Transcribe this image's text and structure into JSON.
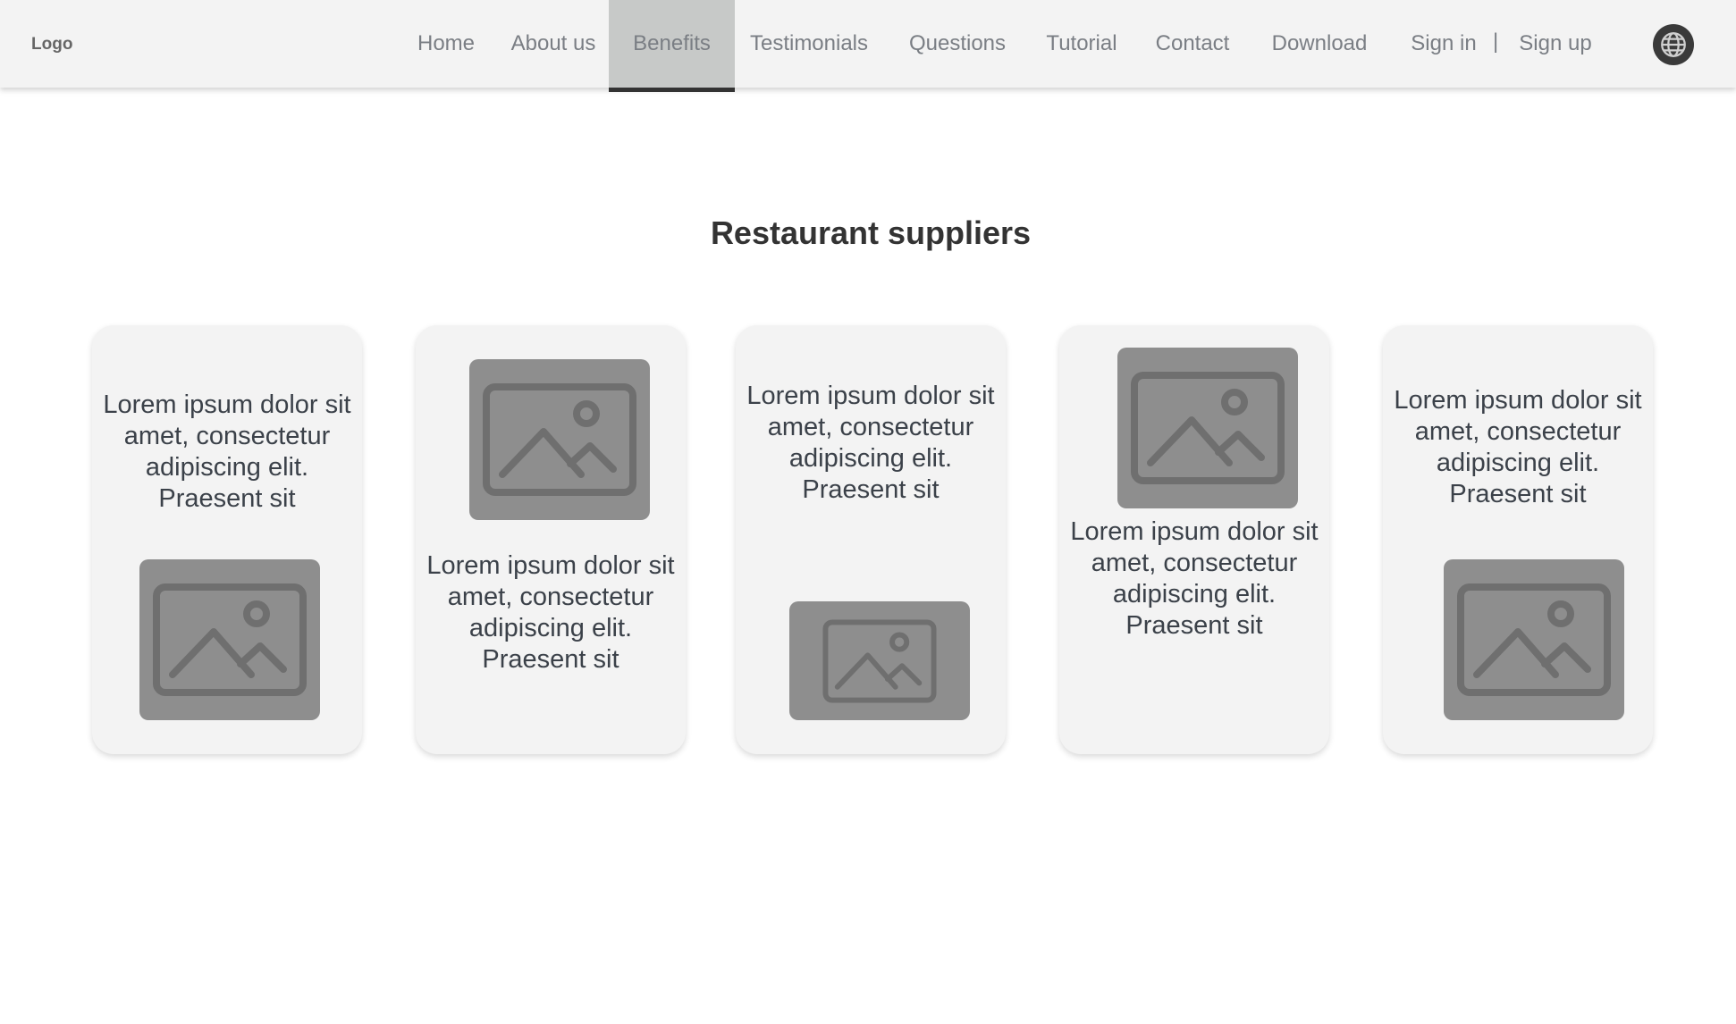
{
  "header": {
    "logo": "Logo",
    "nav": [
      {
        "label": "Home"
      },
      {
        "label": "About us"
      },
      {
        "label": "Benefits",
        "active": true
      },
      {
        "label": "Testimonials"
      },
      {
        "label": "Questions"
      },
      {
        "label": "Tutorial"
      },
      {
        "label": "Contact"
      },
      {
        "label": "Download"
      }
    ],
    "sign_in": "Sign in",
    "separator": "|",
    "sign_up": "Sign up",
    "globe_icon": "globe-icon"
  },
  "main": {
    "title": "Restaurant suppliers",
    "cards": [
      {
        "text": "Lorem ipsum dolor sit amet, consectetur adipiscing elit. Praesent sit",
        "image_icon": "image-icon"
      },
      {
        "text": "Lorem ipsum dolor sit amet, consectetur adipiscing elit. Praesent sit",
        "image_icon": "image-icon"
      },
      {
        "text": "Lorem ipsum dolor sit amet, consectetur adipiscing elit. Praesent sit",
        "image_icon": "image-icon"
      },
      {
        "text": "Lorem ipsum dolor sit amet, consectetur adipiscing elit. Praesent sit",
        "image_icon": "image-icon"
      },
      {
        "text": "Lorem ipsum dolor sit amet, consectetur adipiscing elit. Praesent sit",
        "image_icon": "image-icon"
      }
    ]
  },
  "colors": {
    "header_bg": "#f3f3f3",
    "active_tab_bg": "#c7c9c8",
    "card_bg": "#f3f3f3",
    "placeholder_bg": "#8e8e8e",
    "text": "#333333"
  }
}
